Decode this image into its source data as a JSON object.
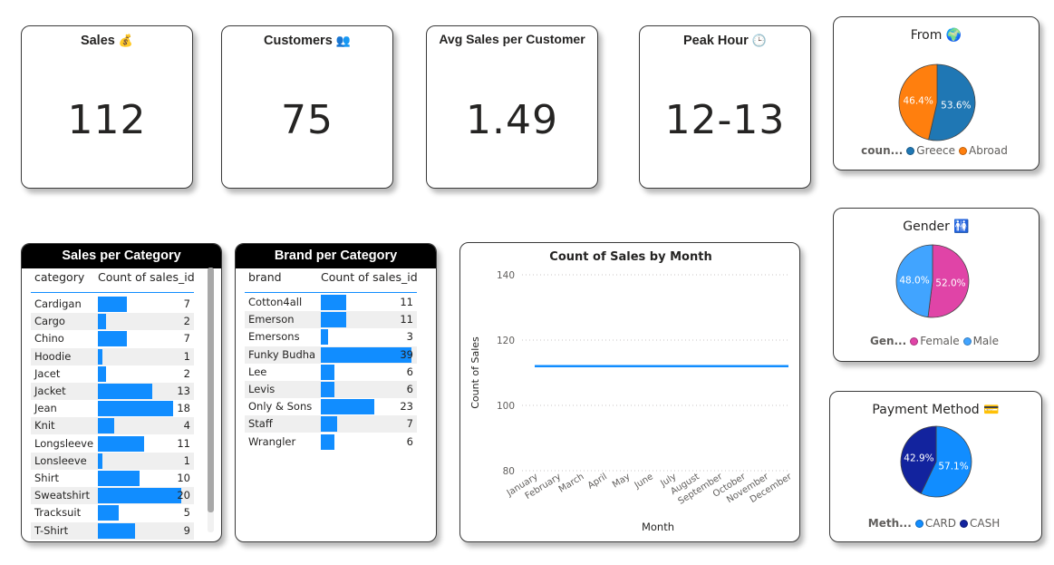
{
  "kpis": {
    "sales": {
      "title": "Sales",
      "emoji": "💰",
      "value": "112"
    },
    "customers": {
      "title": "Customers",
      "emoji": "👥",
      "value": "75"
    },
    "avg": {
      "title": "Avg Sales per Customer",
      "value": "1.49"
    },
    "peak": {
      "title": "Peak Hour",
      "emoji": "🕒",
      "value": "12-13"
    }
  },
  "pies": {
    "from": {
      "title": "From",
      "emoji": "🌍",
      "legend_title": "coun...",
      "slices": [
        {
          "name": "Greece",
          "value": 53.6,
          "label": "53.6%",
          "color": "#1f77b4"
        },
        {
          "name": "Abroad",
          "value": 46.4,
          "label": "46.4%",
          "color": "#ff7f0e"
        }
      ]
    },
    "gender": {
      "title": "Gender",
      "emoji": "🚻",
      "legend_title": "Gen...",
      "slices": [
        {
          "name": "Female",
          "value": 52.0,
          "label": "52.0%",
          "color": "#e044a7"
        },
        {
          "name": "Male",
          "value": 48.0,
          "label": "48.0%",
          "color": "#41a4ff"
        }
      ]
    },
    "payment": {
      "title": "Payment Method",
      "emoji": "💳",
      "legend_title": "Meth...",
      "slices": [
        {
          "name": "CARD",
          "value": 57.1,
          "label": "57.1%",
          "color": "#118dff"
        },
        {
          "name": "CASH",
          "value": 42.9,
          "label": "42.9%",
          "color": "#12239e"
        }
      ]
    }
  },
  "tables": {
    "category": {
      "title": "Sales per Category",
      "col1": "category",
      "col2": "Count of sales_id",
      "max": 20,
      "rows": [
        {
          "label": "Cardigan",
          "value": 7
        },
        {
          "label": "Cargo",
          "value": 2
        },
        {
          "label": "Chino",
          "value": 7
        },
        {
          "label": "Hoodie",
          "value": 1
        },
        {
          "label": "Jacet",
          "value": 2
        },
        {
          "label": "Jacket",
          "value": 13
        },
        {
          "label": "Jean",
          "value": 18
        },
        {
          "label": "Knit",
          "value": 4
        },
        {
          "label": "Longsleeve",
          "value": 11
        },
        {
          "label": "Lonsleeve",
          "value": 1
        },
        {
          "label": "Shirt",
          "value": 10
        },
        {
          "label": "Sweatshirt",
          "value": 20
        },
        {
          "label": "Tracksuit",
          "value": 5
        },
        {
          "label": "T-Shirt",
          "value": 9
        }
      ]
    },
    "brand": {
      "title": "Brand per Category",
      "col1": "brand",
      "col2": "Count of sales_id",
      "max": 39,
      "rows": [
        {
          "label": "Cotton4all",
          "value": 11
        },
        {
          "label": "Emerson",
          "value": 11
        },
        {
          "label": "Emersons",
          "value": 3
        },
        {
          "label": "Funky Budha",
          "value": 39
        },
        {
          "label": "Lee",
          "value": 6
        },
        {
          "label": "Levis",
          "value": 6
        },
        {
          "label": "Only & Sons",
          "value": 23
        },
        {
          "label": "Staff",
          "value": 7
        },
        {
          "label": "Wrangler",
          "value": 6
        }
      ]
    }
  },
  "chart_data": [
    {
      "type": "line",
      "title": "Count of Sales by Month",
      "xlabel": "Month",
      "ylabel": "Count of Sales",
      "x": [
        "January",
        "February",
        "March",
        "April",
        "May",
        "June",
        "July",
        "August",
        "September",
        "October",
        "November",
        "December"
      ],
      "series": [
        {
          "values": [
            112,
            112,
            112,
            112,
            112,
            112,
            112,
            112,
            112,
            112,
            112,
            112
          ]
        }
      ],
      "ylim": [
        80,
        140
      ],
      "yticks": [
        80,
        100,
        120,
        140
      ],
      "grid": true,
      "color": "#118dff"
    },
    {
      "type": "pie",
      "title": "From",
      "legend_title": "coun...",
      "categories": [
        "Greece",
        "Abroad"
      ],
      "values": [
        53.6,
        46.4
      ]
    },
    {
      "type": "pie",
      "title": "Gender",
      "legend_title": "Gen...",
      "categories": [
        "Female",
        "Male"
      ],
      "values": [
        52.0,
        48.0
      ]
    },
    {
      "type": "pie",
      "title": "Payment Method",
      "legend_title": "Meth...",
      "categories": [
        "CARD",
        "CASH"
      ],
      "values": [
        57.1,
        42.9
      ]
    },
    {
      "type": "bar",
      "title": "Sales per Category",
      "categories": [
        "Cardigan",
        "Cargo",
        "Chino",
        "Hoodie",
        "Jacet",
        "Jacket",
        "Jean",
        "Knit",
        "Longsleeve",
        "Lonsleeve",
        "Shirt",
        "Sweatshirt",
        "Tracksuit",
        "T-Shirt"
      ],
      "values": [
        7,
        2,
        7,
        1,
        2,
        13,
        18,
        4,
        11,
        1,
        10,
        20,
        5,
        9
      ]
    },
    {
      "type": "bar",
      "title": "Brand per Category",
      "categories": [
        "Cotton4all",
        "Emerson",
        "Emersons",
        "Funky Budha",
        "Lee",
        "Levis",
        "Only & Sons",
        "Staff",
        "Wrangler"
      ],
      "values": [
        11,
        11,
        3,
        39,
        6,
        6,
        23,
        7,
        6
      ]
    }
  ]
}
